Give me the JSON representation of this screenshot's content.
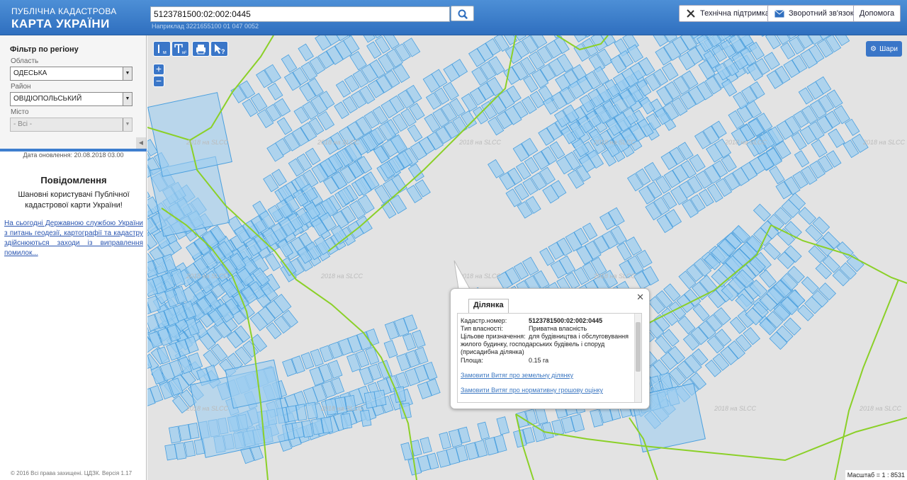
{
  "header": {
    "logo_line1": "ПУБЛІЧНА КАДАСТРОВА",
    "logo_line2": "КАРТА УКРАЇНИ",
    "search_value": "5123781500:02:002:0445",
    "search_hint": "Наприклад  3221655100 01 047 0052",
    "btn_support": "Технічна підтримка",
    "btn_feedback": "Зворотний зв'язок",
    "btn_help": "Допомога"
  },
  "sidebar": {
    "filter_title": "Фільтр по регіону",
    "region_label": "Область",
    "region_value": "ОДЕСЬКА",
    "district_label": "Район",
    "district_value": "ОВІДІОПОЛЬСЬКИЙ",
    "city_label": "Місто",
    "city_value": "- Всі -",
    "updated": "Дата оновлення: 20.08.2018 03.00",
    "notice_title": "Повідомлення",
    "notice_text": "Шановні користувачі Публічної кадастрової карти України!",
    "notice_link": "На сьогодні Державною службою України з питань геодезії, картографії та кадастру здійснюються заходи із виправлення помилок...",
    "copyright": "© 2016 Всі права захищені. ЦДЗК. Версія 1.17"
  },
  "map": {
    "layers_label": "Шари",
    "scale_label": "Масштаб = 1 : 8531",
    "watermark": "2018 на SLCC",
    "tools": [
      "ruler-line",
      "ruler-area",
      "print",
      "identify"
    ]
  },
  "popup": {
    "tab": "Ділянка",
    "rows": [
      {
        "label": "Кадастр.номер:",
        "value": "5123781500:02:002:0445"
      },
      {
        "label": "Тип власності:",
        "value": "Приватна власність"
      },
      {
        "label": "Цільове призначення:",
        "value": "для будівництва і обслуговування"
      },
      {
        "label": "",
        "value": "жилого будинку, господарських будівель і споруд"
      },
      {
        "label": "",
        "value": "(присадибна ділянка)"
      },
      {
        "label": "Площа:",
        "value": "0.15 га"
      }
    ],
    "link1": "Замовити Витяг про земельну ділянку",
    "link2": "Замовити Витяг про нормативну грошову оцінку"
  },
  "colors": {
    "accent": "#3a76c8",
    "parcel_fill": "#9ccdf0",
    "parcel_stroke": "#4a9fde",
    "boundary": "#8bd028"
  }
}
